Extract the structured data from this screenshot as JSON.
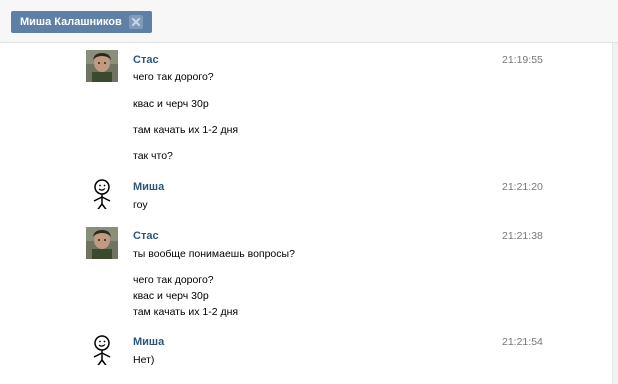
{
  "tab": {
    "title": "Миша Калашников"
  },
  "messages": [
    {
      "author": "Стас",
      "time": "21:19:55",
      "avatar": "photo-avatar",
      "lines": [
        "чего так дорого?",
        "квас и черч 30р",
        "там качать их 1-2 дня",
        "так что?"
      ]
    },
    {
      "author": "Миша",
      "time": "21:21:20",
      "avatar": "stickman-avatar",
      "lines": [
        "гоу"
      ]
    },
    {
      "author": "Стас",
      "time": "21:21:38",
      "avatar": "photo-avatar",
      "lines": [
        "ты вообще понимаешь вопросы?",
        "чего так дорого?",
        "квас и черч 30р",
        "там качать их 1-2 дня"
      ]
    },
    {
      "author": "Миша",
      "time": "21:21:54",
      "avatar": "stickman-avatar",
      "lines": [
        "Нет)"
      ]
    }
  ],
  "colors": {
    "tab_bg": "#5e80a6",
    "author": "#2b587a",
    "time": "#777777"
  }
}
